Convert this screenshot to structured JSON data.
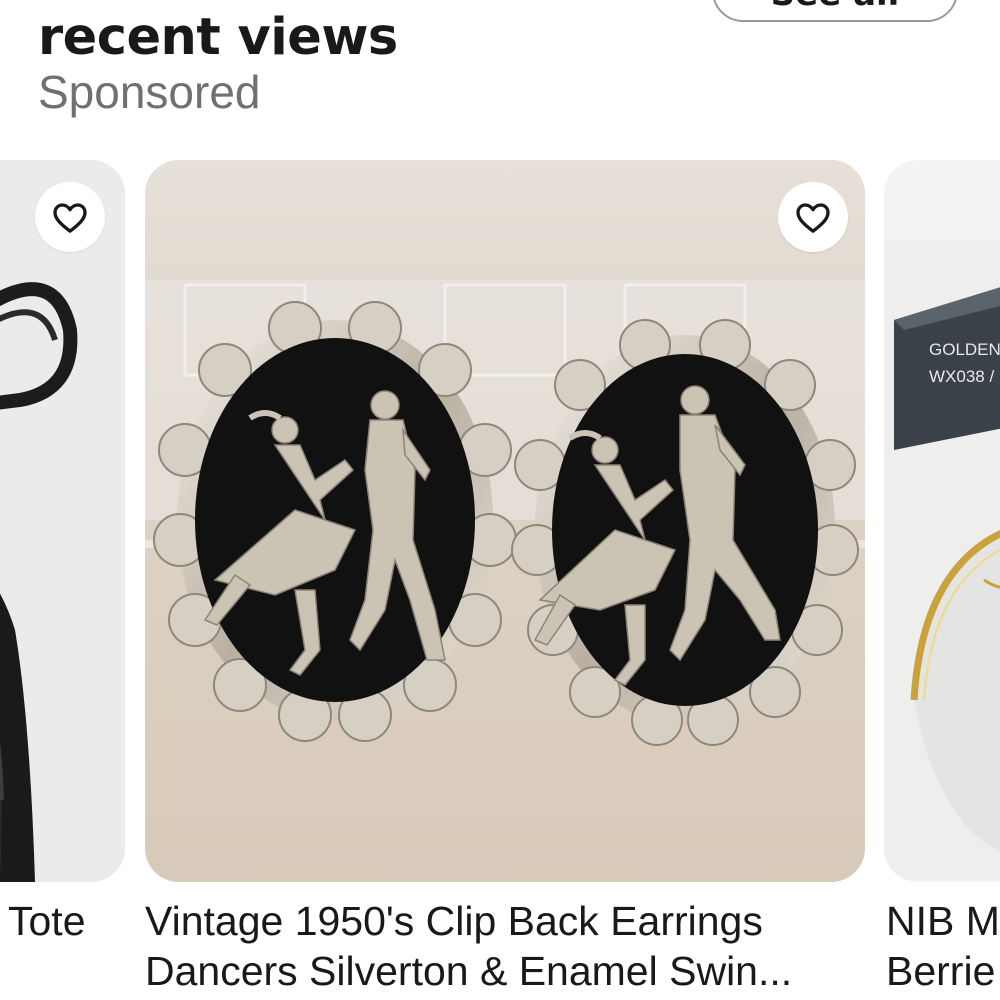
{
  "header": {
    "title": "recent views",
    "subtitle": "Sponsored",
    "see_all_label": "See all"
  },
  "cards": [
    {
      "title_lines": [
        "Tote"
      ],
      "image_icon": "black-leather-tote-photo",
      "favorite_icon": "heart-icon"
    },
    {
      "title_lines": [
        "Vintage 1950's Clip Back Earrings",
        "Dancers  Silverton & Enamel Swin..."
      ],
      "image_icon": "dancer-earrings-photo",
      "favorite_icon": "heart-icon"
    },
    {
      "title_lines": [
        "NIB M",
        "Berrie"
      ],
      "image_icon": "boxed-gold-rim-dish-photo",
      "box_label_lines": [
        "GOLDEN",
        "WX038 /"
      ]
    }
  ],
  "colors": {
    "title_text": "#191919",
    "subtitle_text": "#707070",
    "card_main_bg": "#dcd2c6",
    "enamel_black": "#111111",
    "silver": "#c9c2b6"
  }
}
